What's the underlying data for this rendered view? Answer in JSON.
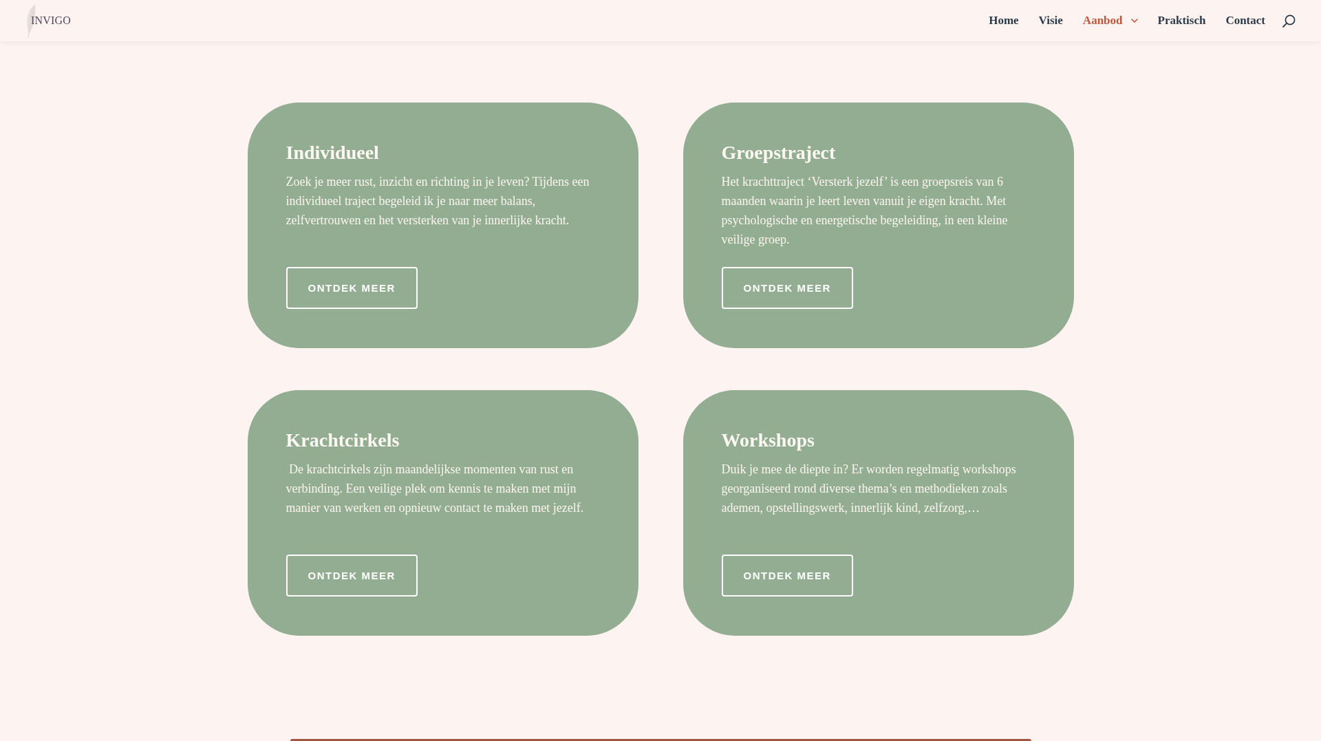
{
  "header": {
    "logo": "INVIGO",
    "nav": [
      {
        "label": "Home",
        "selected": false,
        "submenu": false
      },
      {
        "label": "Visie",
        "selected": false,
        "submenu": false
      },
      {
        "label": "Aanbod",
        "selected": true,
        "submenu": true
      },
      {
        "label": "Praktisch",
        "selected": false,
        "submenu": false
      },
      {
        "label": "Contact",
        "selected": false,
        "submenu": false
      }
    ]
  },
  "cards": [
    {
      "title": "Individueel",
      "text": "Zoek je meer rust, inzicht en richting in je leven? Tijdens een individueel traject begeleid ik je naar meer balans, zelfvertrouwen en het versterken van je innerlijke kracht.",
      "button": "ONTDEK MEER"
    },
    {
      "title": "Groepstraject",
      "text": "Het krachttraject ‘Versterk jezelf’ is een groepsreis van 6 maanden waarin je leert leven vanuit je eigen kracht. Met psychologische en energetische begeleiding, in een kleine veilige groep.",
      "button": "ONTDEK MEER"
    },
    {
      "title": "Krachtcirkels",
      "text": " De krachtcirkels zijn maandelijkse momenten van rust en verbinding. Een veilige plek om kennis te maken met mijn manier van werken en opnieuw contact te maken met jezelf.",
      "button": "ONTDEK MEER"
    },
    {
      "title": "Workshops",
      "text": "Duik je mee de diepte in? Er worden regelmatig workshops georganiseerd rond diverse thema’s en methodieken zoals ademen, opstellingswerk, innerlijk kind, zelfzorg,…",
      "button": "ONTDEK MEER"
    }
  ]
}
